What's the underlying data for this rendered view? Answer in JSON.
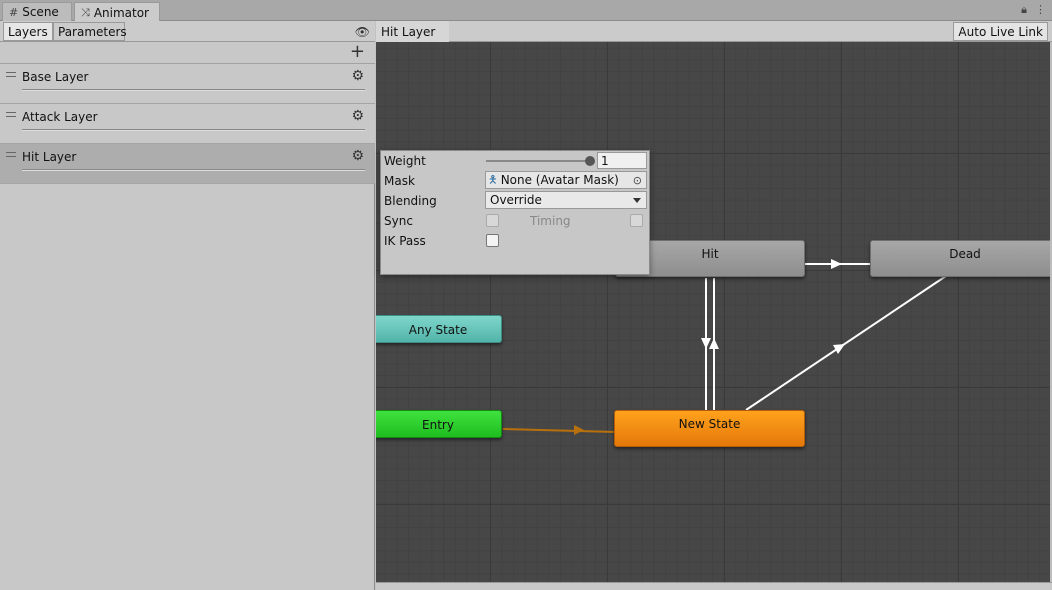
{
  "window": {
    "tabs": [
      {
        "label": "Scene",
        "icon": "grid-icon"
      },
      {
        "label": "Animator",
        "icon": "animator-icon"
      }
    ],
    "controls": [
      "lock-icon",
      "menu-icon"
    ]
  },
  "left_panel": {
    "tabs": [
      {
        "label": "Layers",
        "selected": true
      },
      {
        "label": "Parameters",
        "selected": false
      }
    ],
    "layers": [
      {
        "name": "Base Layer",
        "selected": false
      },
      {
        "name": "Attack Layer",
        "selected": false
      },
      {
        "name": "Hit Layer",
        "selected": true
      }
    ]
  },
  "graph": {
    "breadcrumb": "Hit Layer",
    "auto_live_link": "Auto Live Link",
    "nodes": {
      "hit": "Hit",
      "dead": "Dead",
      "any_state": "Any State",
      "entry": "Entry",
      "new_state": "New State"
    },
    "colors": {
      "default_state": "#cb7a10",
      "any_state": "#5fc0b5",
      "entry": "#2bd02b",
      "state": "#9a9a9a",
      "transition": "#ffffff",
      "entry_transition": "#b8700c",
      "canvas": "#474747"
    }
  },
  "layer_settings": {
    "weight_label": "Weight",
    "weight_value": "1",
    "weight_fraction": 1,
    "mask_label": "Mask",
    "mask_value": "None (Avatar Mask)",
    "blending_label": "Blending",
    "blending_value": "Override",
    "sync_label": "Sync",
    "sync_checked": false,
    "timing_label": "Timing",
    "timing_checked": false,
    "ikpass_label": "IK Pass",
    "ikpass_checked": false
  }
}
